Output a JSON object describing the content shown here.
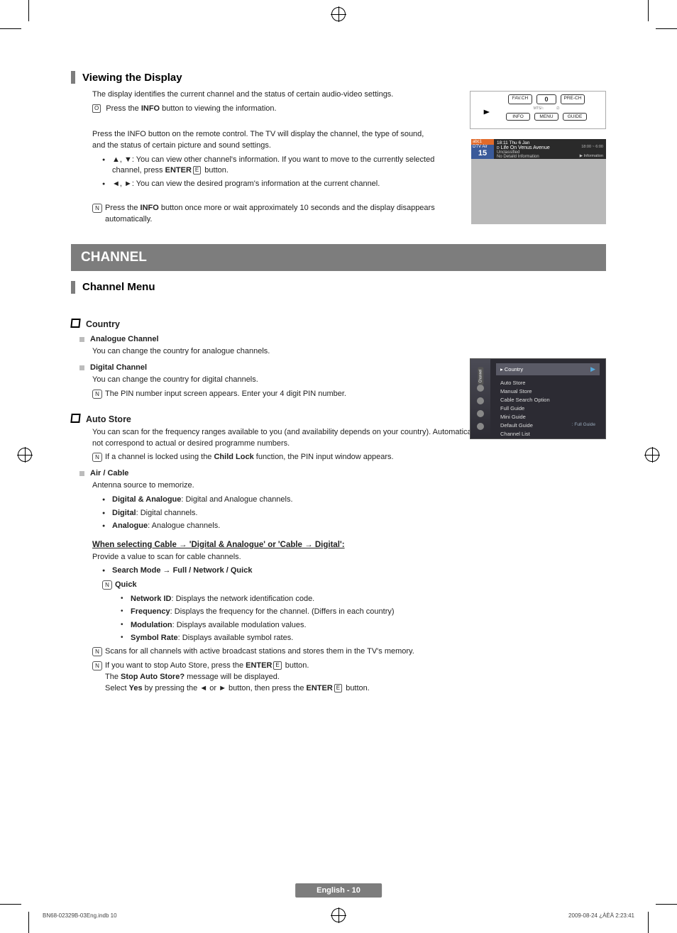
{
  "section1": {
    "heading": "Viewing the Display",
    "intro": "The display identifies the current channel and the status of certain audio-video settings.",
    "press_info": "Press the INFO button to viewing the information.",
    "para2": "Press the INFO button on the remote control. The TV will display the channel, the type of sound, and the status of certain picture and sound settings.",
    "bullet1a": "▲, ▼: You can view other channel's information. If you want to move to the currently selected channel, press ",
    "bullet1b": " button.",
    "enter_label": "ENTER",
    "bullet2": "◄, ►: You can view the desired program's information at the current channel.",
    "note": "Press the INFO button once more or wait approximately 10 seconds and the display disappears automatically."
  },
  "band": "CHANNEL",
  "section2": {
    "heading": "Channel Menu",
    "country": {
      "title": "Country",
      "analogue_h": "Analogue Channel",
      "analogue_t": "You can change the country for analogue channels.",
      "digital_h": "Digital Channel",
      "digital_t": "You can change the country for digital channels.",
      "digital_note": "The PIN number input screen appears. Enter your 4 digit PIN number."
    },
    "autostore": {
      "title": "Auto Store",
      "para": "You can scan for the frequency ranges available to you (and availability depends on your country). Automatically allocated programme numbers may not correspond to actual or desired programme numbers.",
      "note": "If a channel is locked using the Child Lock function, the PIN input window appears.",
      "air_h": "Air / Cable",
      "air_t": "Antenna source to memorize.",
      "opt1_b": "Digital & Analogue",
      "opt1_t": ": Digital and Analogue channels.",
      "opt2_b": "Digital",
      "opt2_t": ": Digital channels.",
      "opt3_b": "Analogue",
      "opt3_t": ": Analogue channels.",
      "cable_h": "When selecting Cable → 'Digital & Analogue' or 'Cable → Digital':",
      "cable_t": "Provide a value to scan for cable channels.",
      "search_b": "Search Mode → Full / Network / Quick",
      "quick_b": "Quick",
      "q1_b": "Network ID",
      "q1_t": ": Displays the network identification code.",
      "q2_b": "Frequency",
      "q2_t": ": Displays the frequency for the channel. (Differs in each country)",
      "q3_b": "Modulation",
      "q3_t": ": Displays available modulation values.",
      "q4_b": "Symbol Rate",
      "q4_t": ": Displays available symbol rates.",
      "scan_note": "Scans for all channels with active broadcast stations and stores them in the TV's memory.",
      "stop_note_a": "If you want to stop Auto Store, press the ",
      "stop_note_b": " button.",
      "stop_msg_a": "The ",
      "stop_msg_bold": "Stop Auto Store?",
      "stop_msg_b": " message will be displayed.",
      "select_a": "Select ",
      "select_yes": "Yes",
      "select_b": " by pressing the ◄ or ► button, then press the ",
      "select_c": " button."
    }
  },
  "remote": {
    "favch": "FAV.CH",
    "zero": "0",
    "prech": "PRE-CH",
    "info": "INFO",
    "menu": "MENU",
    "guide": "GUIDE"
  },
  "osd1": {
    "ch_top": "abc1",
    "ch_mid": "DTV Air",
    "ch_num": "15",
    "time": "18:11 Thu 6 Jan",
    "prog": "Life On Venus Avenue",
    "cls": "Unclassified",
    "nodata": "No Detaild Information",
    "span": "18:00 ~ 6:00",
    "corner": "Information",
    "d": "D"
  },
  "osd2": {
    "tab": "Channel",
    "header": "Country",
    "items": [
      {
        "label": "Auto Store",
        "val": ""
      },
      {
        "label": "Manual Store",
        "val": ""
      },
      {
        "label": "Cable Search Option",
        "val": ""
      },
      {
        "label": "Full Guide",
        "val": ""
      },
      {
        "label": "Mini Guide",
        "val": ""
      },
      {
        "label": "Default Guide",
        "val": ": Full Guide"
      },
      {
        "label": "Channel List",
        "val": ""
      }
    ]
  },
  "footer": {
    "page": "English - 10",
    "left": "BN68-02329B-03Eng.indb   10",
    "right": "2009-08-24   ¿ÀÈÄ 2:23:41"
  },
  "icons": {
    "remote_O": "O",
    "note_N": "N",
    "enter_glyph": "E"
  }
}
